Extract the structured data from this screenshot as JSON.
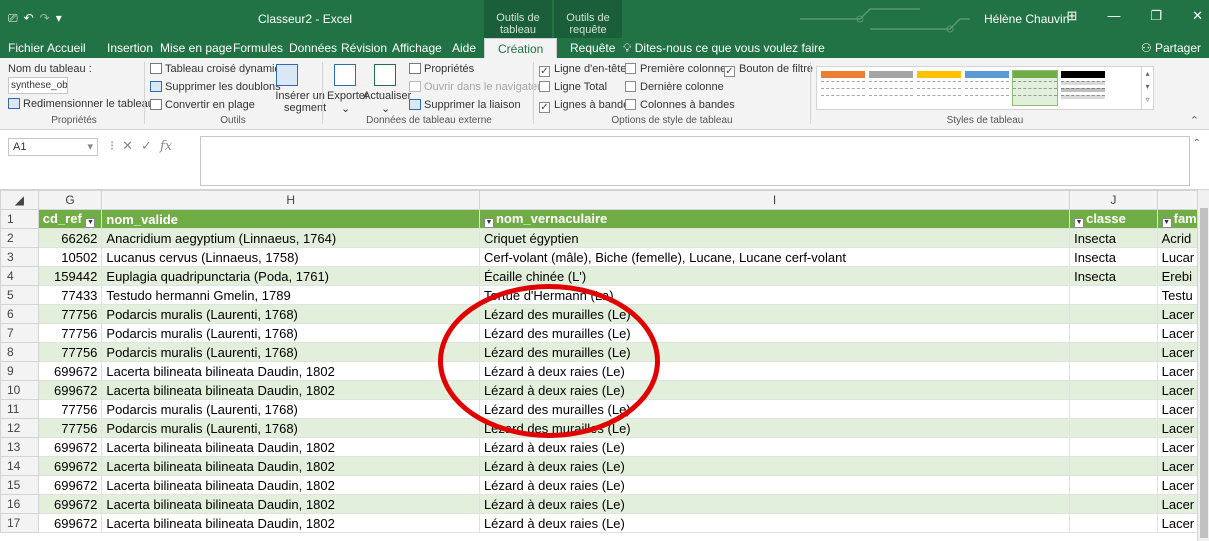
{
  "titlebar": {
    "quick_access": [
      "⎚",
      "↶",
      "↷",
      "▾"
    ],
    "title": "Classeur2 - Excel",
    "context_tabs": [
      "Outils de tableau",
      "Outils de requête"
    ],
    "user": "Hélène Chauvin",
    "window_buttons": [
      "⊞",
      "—",
      "❐",
      "✕"
    ]
  },
  "tabs": {
    "items": [
      "Fichier",
      "Accueil",
      "Insertion",
      "Mise en page",
      "Formules",
      "Données",
      "Révision",
      "Affichage",
      "Aide",
      "Création",
      "Requête"
    ],
    "active": "Création",
    "tell_me": "Dites-nous ce que vous voulez faire",
    "share": "Partager"
  },
  "ribbon": {
    "proprietes": {
      "table_name_label": "Nom du tableau :",
      "table_name_value": "synthese_obser",
      "resize": "Redimensionner le tableau",
      "group": "Propriétés"
    },
    "outils": {
      "pivot": "Tableau croisé dynamique",
      "dedupe": "Supprimer les doublons",
      "convert": "Convertir en plage",
      "slicer_line1": "Insérer un",
      "slicer_line2": "segment",
      "group": "Outils"
    },
    "externe": {
      "export": "Exporter",
      "refresh": "Actualiser",
      "properties": "Propriétés",
      "open_browser": "Ouvrir dans le navigateur",
      "unlink": "Supprimer la liaison",
      "group": "Données de tableau externe"
    },
    "options": {
      "header_row": "Ligne d'en-tête",
      "total_row": "Ligne Total",
      "banded_rows": "Lignes à bandes",
      "first_col": "Première colonne",
      "last_col": "Dernière colonne",
      "banded_cols": "Colonnes à bandes",
      "filter_btn": "Bouton de filtre",
      "header_row_checked": true,
      "total_row_checked": false,
      "banded_rows_checked": true,
      "first_col_checked": false,
      "last_col_checked": false,
      "banded_cols_checked": false,
      "filter_btn_checked": true,
      "group": "Options de style de tableau"
    },
    "styles": {
      "group": "Styles de tableau",
      "swatch_colors": [
        "#ed7d31",
        "#a5a5a5",
        "#ffc000",
        "#5b9bd5",
        "#70ad47",
        "#000000"
      ]
    }
  },
  "formula_bar": {
    "name_box": "A1",
    "fx": "fx",
    "content": ""
  },
  "grid": {
    "columns": [
      "G",
      "H",
      "I",
      "J",
      ""
    ],
    "header": [
      "cd_ref",
      "nom_valide",
      "nom_vernaculaire",
      "classe",
      "famil"
    ],
    "rows": [
      {
        "n": "2",
        "cd_ref": "66262",
        "nom_valide": "Anacridium aegyptium (Linnaeus, 1764)",
        "nom_vernaculaire": "Criquet égyptien",
        "classe": "Insecta",
        "famille": "Acrid"
      },
      {
        "n": "3",
        "cd_ref": "10502",
        "nom_valide": "Lucanus cervus (Linnaeus, 1758)",
        "nom_vernaculaire": "Cerf-volant (mâle), Biche (femelle), Lucane, Lucane cerf-volant",
        "classe": "Insecta",
        "famille": "Lucar"
      },
      {
        "n": "4",
        "cd_ref": "159442",
        "nom_valide": "Euplagia quadripunctaria (Poda, 1761)",
        "nom_vernaculaire": "Écaille chinée (L')",
        "classe": "Insecta",
        "famille": "Erebi"
      },
      {
        "n": "5",
        "cd_ref": "77433",
        "nom_valide": "Testudo hermanni Gmelin, 1789",
        "nom_vernaculaire": "Tortue d'Hermann (La)",
        "classe": "",
        "famille": "Testu"
      },
      {
        "n": "6",
        "cd_ref": "77756",
        "nom_valide": "Podarcis muralis (Laurenti, 1768)",
        "nom_vernaculaire": "Lézard des murailles (Le)",
        "classe": "",
        "famille": "Lacer"
      },
      {
        "n": "7",
        "cd_ref": "77756",
        "nom_valide": "Podarcis muralis (Laurenti, 1768)",
        "nom_vernaculaire": "Lézard des murailles (Le)",
        "classe": "",
        "famille": "Lacer"
      },
      {
        "n": "8",
        "cd_ref": "77756",
        "nom_valide": "Podarcis muralis (Laurenti, 1768)",
        "nom_vernaculaire": "Lézard des murailles (Le)",
        "classe": "",
        "famille": "Lacer"
      },
      {
        "n": "9",
        "cd_ref": "699672",
        "nom_valide": "Lacerta bilineata bilineata Daudin, 1802",
        "nom_vernaculaire": "Lézard à deux raies (Le)",
        "classe": "",
        "famille": "Lacer"
      },
      {
        "n": "10",
        "cd_ref": "699672",
        "nom_valide": "Lacerta bilineata bilineata Daudin, 1802",
        "nom_vernaculaire": "Lézard à deux raies (Le)",
        "classe": "",
        "famille": "Lacer"
      },
      {
        "n": "11",
        "cd_ref": "77756",
        "nom_valide": "Podarcis muralis (Laurenti, 1768)",
        "nom_vernaculaire": "Lézard des murailles (Le)",
        "classe": "",
        "famille": "Lacer"
      },
      {
        "n": "12",
        "cd_ref": "77756",
        "nom_valide": "Podarcis muralis (Laurenti, 1768)",
        "nom_vernaculaire": "Lézard des murailles (Le)",
        "classe": "",
        "famille": "Lacer"
      },
      {
        "n": "13",
        "cd_ref": "699672",
        "nom_valide": "Lacerta bilineata bilineata Daudin, 1802",
        "nom_vernaculaire": "Lézard à deux raies (Le)",
        "classe": "",
        "famille": "Lacer"
      },
      {
        "n": "14",
        "cd_ref": "699672",
        "nom_valide": "Lacerta bilineata bilineata Daudin, 1802",
        "nom_vernaculaire": "Lézard à deux raies (Le)",
        "classe": "",
        "famille": "Lacer"
      },
      {
        "n": "15",
        "cd_ref": "699672",
        "nom_valide": "Lacerta bilineata bilineata Daudin, 1802",
        "nom_vernaculaire": "Lézard à deux raies (Le)",
        "classe": "",
        "famille": "Lacer"
      },
      {
        "n": "16",
        "cd_ref": "699672",
        "nom_valide": "Lacerta bilineata bilineata Daudin, 1802",
        "nom_vernaculaire": "Lézard à deux raies (Le)",
        "classe": "",
        "famille": "Lacer"
      },
      {
        "n": "17",
        "cd_ref": "699672",
        "nom_valide": "Lacerta bilineata bilineata Daudin, 1802",
        "nom_vernaculaire": "Lézard à deux raies (Le)",
        "classe": "",
        "famille": "Lacer"
      }
    ]
  },
  "colors": {
    "excel_green": "#217346",
    "table_header": "#70ad47",
    "band": "#e2efda",
    "annotation": "#e00000"
  }
}
